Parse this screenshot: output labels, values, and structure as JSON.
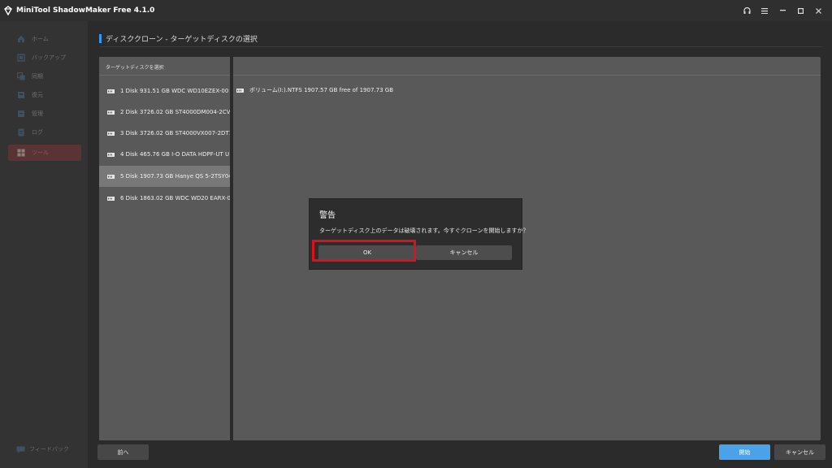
{
  "app": {
    "title": "MiniTool ShadowMaker Free 4.1.0",
    "logo_icon": "minitool-logo-icon"
  },
  "window_controls": {
    "headset": "headset-icon",
    "menu": "menu-icon",
    "minimize": "minimize-icon",
    "maximize": "maximize-icon",
    "close": "close-icon"
  },
  "sidebar": {
    "items": [
      {
        "label": "ホーム",
        "icon": "home-icon",
        "active": false
      },
      {
        "label": "バックアップ",
        "icon": "backup-icon",
        "active": false
      },
      {
        "label": "同期",
        "icon": "sync-icon",
        "active": false
      },
      {
        "label": "復元",
        "icon": "restore-icon",
        "active": false
      },
      {
        "label": "管理",
        "icon": "manage-icon",
        "active": false
      },
      {
        "label": "ログ",
        "icon": "log-icon",
        "active": false
      },
      {
        "label": "ツール",
        "icon": "tools-icon",
        "active": true
      }
    ],
    "feedback_label": "フィードバック"
  },
  "main": {
    "page_title": "ディスククローン - ターゲットディスクの選択",
    "panel_header": "ターゲットディスクを選択",
    "disks": [
      {
        "label": "1 Disk 931.51 GB WDC WD10EZEX-00",
        "selected": false
      },
      {
        "label": "2 Disk 3726.02 GB ST4000DM004-2CV",
        "selected": false
      },
      {
        "label": "3 Disk 3726.02 GB ST4000VX007-2DT1",
        "selected": false
      },
      {
        "label": "4 Disk 465.76 GB I-O DATA HDPF-UT U",
        "selected": false
      },
      {
        "label": "5 Disk 1907.73 GB Hanye QS 5-2TSY04",
        "selected": true
      },
      {
        "label": "6 Disk 1863.02 GB WDC WD20 EARX-0",
        "selected": false
      }
    ],
    "volume": {
      "label": "ボリューム(I:).NTFS   1907.57 GB free of 1907.73 GB"
    }
  },
  "buttons": {
    "back": "前へ",
    "start": "開始",
    "cancel": "キャンセル"
  },
  "dialog": {
    "title": "警告",
    "message": "ターゲットディスク上のデータは破壊されます。今すぐクローンを開始しますか？",
    "ok": "OK",
    "cancel": "キャンセル"
  },
  "colors": {
    "accent": "#4aa2ea",
    "highlight": "#e0101a",
    "active_sidebar": "#5a3434"
  }
}
